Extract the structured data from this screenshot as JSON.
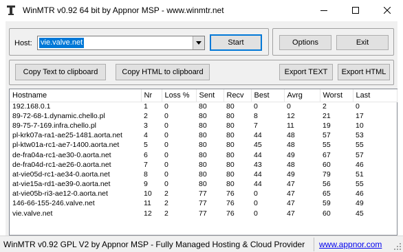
{
  "window": {
    "title": "WinMTR v0.92 64 bit by Appnor MSP - www.winmtr.net",
    "icon": "winmtr-app-icon",
    "controls": {
      "minimize": "minimize-icon",
      "maximize": "maximize-icon",
      "close": "close-icon"
    }
  },
  "host": {
    "label": "Host:",
    "value": "vie.valve.net",
    "start_label": "Start"
  },
  "actions": {
    "options_label": "Options",
    "exit_label": "Exit",
    "copy_text_label": "Copy Text to clipboard",
    "copy_html_label": "Copy HTML to clipboard",
    "export_text_label": "Export TEXT",
    "export_html_label": "Export HTML"
  },
  "table": {
    "columns": [
      "Hostname",
      "Nr",
      "Loss %",
      "Sent",
      "Recv",
      "Best",
      "Avrg",
      "Worst",
      "Last"
    ],
    "rows": [
      [
        "192.168.0.1",
        "1",
        "0",
        "80",
        "80",
        "0",
        "0",
        "2",
        "0"
      ],
      [
        "89-72-68-1.dynamic.chello.pl",
        "2",
        "0",
        "80",
        "80",
        "8",
        "12",
        "21",
        "17"
      ],
      [
        "89-75-7-169.infra.chello.pl",
        "3",
        "0",
        "80",
        "80",
        "7",
        "11",
        "19",
        "10"
      ],
      [
        "pl-krk07a-ra1-ae25-1481.aorta.net",
        "4",
        "0",
        "80",
        "80",
        "44",
        "48",
        "57",
        "53"
      ],
      [
        "pl-ktw01a-rc1-ae7-1400.aorta.net",
        "5",
        "0",
        "80",
        "80",
        "45",
        "48",
        "55",
        "55"
      ],
      [
        "de-fra04a-rc1-ae30-0.aorta.net",
        "6",
        "0",
        "80",
        "80",
        "44",
        "49",
        "67",
        "57"
      ],
      [
        "de-fra04d-rc1-ae26-0.aorta.net",
        "7",
        "0",
        "80",
        "80",
        "43",
        "48",
        "60",
        "46"
      ],
      [
        "at-vie05d-rc1-ae34-0.aorta.net",
        "8",
        "0",
        "80",
        "80",
        "44",
        "49",
        "79",
        "51"
      ],
      [
        "at-vie15a-rd1-ae39-0.aorta.net",
        "9",
        "0",
        "80",
        "80",
        "44",
        "47",
        "56",
        "55"
      ],
      [
        "at-vie05b-ri3-ae12-0.aorta.net",
        "10",
        "2",
        "77",
        "76",
        "0",
        "47",
        "65",
        "46"
      ],
      [
        "146-66-155-246.valve.net",
        "11",
        "2",
        "77",
        "76",
        "0",
        "47",
        "59",
        "49"
      ],
      [
        "vie.valve.net",
        "12",
        "2",
        "77",
        "76",
        "0",
        "47",
        "60",
        "45"
      ]
    ]
  },
  "status": {
    "text": "WinMTR v0.92 GPL V2 by Appnor MSP - Fully Managed Hosting & Cloud Provider",
    "link": "www.appnor.com"
  }
}
